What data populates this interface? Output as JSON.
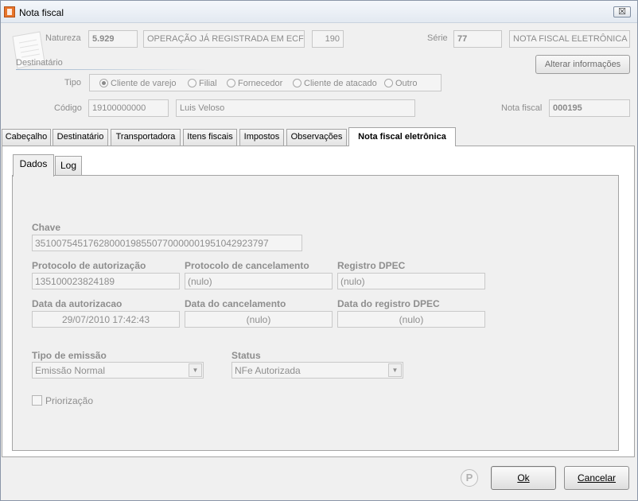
{
  "window": {
    "title": "Nota fiscal",
    "close_label": "☒"
  },
  "header": {
    "natureza_label": "Natureza",
    "natureza_code": "5.929",
    "natureza_desc": "OPERAÇÃO JÁ REGISTRADA EM ECF",
    "natureza_num": "190",
    "serie_label": "Série",
    "serie_value": "77",
    "serie_desc": "NOTA FISCAL ELETRÔNICA",
    "destinatario_label": "Destinatário",
    "alterar_label": "Alterar informações",
    "tipo_label": "Tipo",
    "tipo_options": [
      "Cliente de varejo",
      "Filial",
      "Fornecedor",
      "Cliente de atacado",
      "Outro"
    ],
    "codigo_label": "Código",
    "codigo_value": "19100000000",
    "nome_value": "Luis Veloso",
    "nota_fiscal_label": "Nota fiscal",
    "nota_fiscal_value": "000195"
  },
  "tabs": [
    {
      "label": "Cabeçalho"
    },
    {
      "label": "Destinatário"
    },
    {
      "label": "Transportadora"
    },
    {
      "label": "Itens fiscais"
    },
    {
      "label": "Impostos"
    },
    {
      "label": "Observações"
    },
    {
      "label": "Nota fiscal eletrônica"
    }
  ],
  "subtabs": [
    {
      "label": "Dados"
    },
    {
      "label": "Log"
    }
  ],
  "dados": {
    "chave_label": "Chave",
    "chave_value": "35100754517628000198550770000001951042923797",
    "protocolo_aut_label": "Protocolo de autorização",
    "protocolo_aut_value": "135100023824189",
    "protocolo_canc_label": "Protocolo de cancelamento",
    "protocolo_canc_value": "(nulo)",
    "registro_dpec_label": "Registro DPEC",
    "registro_dpec_value": "(nulo)",
    "data_aut_label": "Data da autorizacao",
    "data_aut_value": "29/07/2010 17:42:43",
    "data_canc_label": "Data do cancelamento",
    "data_canc_value": "(nulo)",
    "data_dpec_label": "Data do registro DPEC",
    "data_dpec_value": "(nulo)",
    "tipo_emissao_label": "Tipo de emissão",
    "tipo_emissao_value": "Emissão Normal",
    "status_label": "Status",
    "status_value": "NFe Autorizada",
    "priorizacao_label": "Priorização"
  },
  "footer": {
    "p_label": "P",
    "ok_label": "Ok",
    "cancel_label": "Cancelar"
  }
}
